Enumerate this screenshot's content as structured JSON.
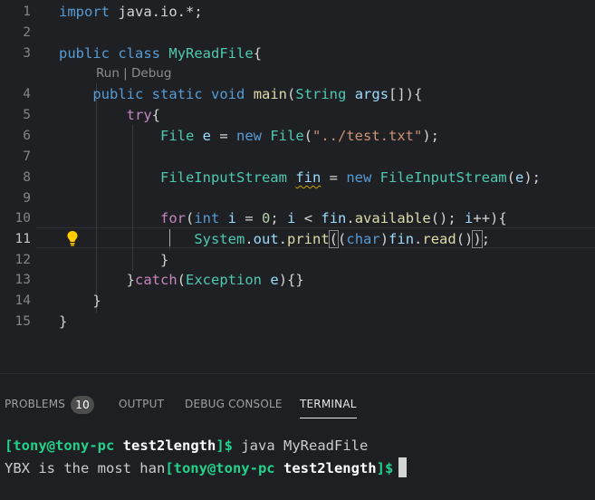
{
  "editor": {
    "codelens": "Run | Debug",
    "lines": [
      {
        "num": "1",
        "tokens": [
          {
            "c": "k",
            "t": "import"
          },
          {
            "c": "p",
            "t": " java.io.*;"
          }
        ]
      },
      {
        "num": "2",
        "tokens": []
      },
      {
        "num": "3",
        "tokens": [
          {
            "c": "k",
            "t": "public"
          },
          {
            "c": "p",
            "t": " "
          },
          {
            "c": "k",
            "t": "class"
          },
          {
            "c": "p",
            "t": " "
          },
          {
            "c": "t",
            "t": "MyReadFile"
          },
          {
            "c": "p",
            "t": "{"
          }
        ]
      },
      {
        "num": "4",
        "tokens": [
          {
            "c": "p",
            "t": "    "
          },
          {
            "c": "k",
            "t": "public"
          },
          {
            "c": "p",
            "t": " "
          },
          {
            "c": "k",
            "t": "static"
          },
          {
            "c": "p",
            "t": " "
          },
          {
            "c": "k",
            "t": "void"
          },
          {
            "c": "p",
            "t": " "
          },
          {
            "c": "f",
            "t": "main"
          },
          {
            "c": "p",
            "t": "("
          },
          {
            "c": "t",
            "t": "String"
          },
          {
            "c": "p",
            "t": " "
          },
          {
            "c": "v",
            "t": "args"
          },
          {
            "c": "p",
            "t": "[]){"
          }
        ]
      },
      {
        "num": "5",
        "tokens": [
          {
            "c": "p",
            "t": "        "
          },
          {
            "c": "kc",
            "t": "try"
          },
          {
            "c": "p",
            "t": "{"
          }
        ]
      },
      {
        "num": "6",
        "tokens": [
          {
            "c": "p",
            "t": "            "
          },
          {
            "c": "t",
            "t": "File"
          },
          {
            "c": "p",
            "t": " "
          },
          {
            "c": "v",
            "t": "e"
          },
          {
            "c": "p",
            "t": " = "
          },
          {
            "c": "k",
            "t": "new"
          },
          {
            "c": "p",
            "t": " "
          },
          {
            "c": "t",
            "t": "File"
          },
          {
            "c": "p",
            "t": "("
          },
          {
            "c": "s",
            "t": "\"../test.txt\""
          },
          {
            "c": "p",
            "t": ");"
          }
        ]
      },
      {
        "num": "7",
        "tokens": []
      },
      {
        "num": "8",
        "tokens": [
          {
            "c": "p",
            "t": "            "
          },
          {
            "c": "t",
            "t": "FileInputStream"
          },
          {
            "c": "p",
            "t": " "
          },
          {
            "c": "v squig",
            "t": "fin"
          },
          {
            "c": "p",
            "t": " = "
          },
          {
            "c": "k",
            "t": "new"
          },
          {
            "c": "p",
            "t": " "
          },
          {
            "c": "t",
            "t": "FileInputStream"
          },
          {
            "c": "p",
            "t": "("
          },
          {
            "c": "v",
            "t": "e"
          },
          {
            "c": "p",
            "t": ");"
          }
        ]
      },
      {
        "num": "9",
        "tokens": []
      },
      {
        "num": "10",
        "tokens": [
          {
            "c": "p",
            "t": "            "
          },
          {
            "c": "kc",
            "t": "for"
          },
          {
            "c": "p",
            "t": "("
          },
          {
            "c": "k",
            "t": "int"
          },
          {
            "c": "p",
            "t": " "
          },
          {
            "c": "v",
            "t": "i"
          },
          {
            "c": "p",
            "t": " = "
          },
          {
            "c": "n",
            "t": "0"
          },
          {
            "c": "p",
            "t": "; "
          },
          {
            "c": "v",
            "t": "i"
          },
          {
            "c": "p",
            "t": " < "
          },
          {
            "c": "v",
            "t": "fin"
          },
          {
            "c": "p",
            "t": "."
          },
          {
            "c": "f",
            "t": "available"
          },
          {
            "c": "p",
            "t": "(); "
          },
          {
            "c": "v",
            "t": "i"
          },
          {
            "c": "p",
            "t": "++){"
          }
        ]
      },
      {
        "num": "11",
        "tokens": [
          {
            "c": "p",
            "t": "                "
          },
          {
            "c": "t",
            "t": "System"
          },
          {
            "c": "p",
            "t": "."
          },
          {
            "c": "v",
            "t": "out"
          },
          {
            "c": "p",
            "t": "."
          },
          {
            "c": "f",
            "t": "print"
          },
          {
            "c": "p bm",
            "t": "("
          },
          {
            "c": "p",
            "t": "("
          },
          {
            "c": "k",
            "t": "char"
          },
          {
            "c": "p",
            "t": ")"
          },
          {
            "c": "v",
            "t": "fin"
          },
          {
            "c": "p",
            "t": "."
          },
          {
            "c": "f",
            "t": "read"
          },
          {
            "c": "p",
            "t": "()"
          },
          {
            "c": "p bm",
            "t": ")"
          },
          {
            "c": "p",
            "t": ";"
          }
        ]
      },
      {
        "num": "12",
        "tokens": [
          {
            "c": "p",
            "t": "            }"
          }
        ]
      },
      {
        "num": "13",
        "tokens": [
          {
            "c": "p",
            "t": "        }"
          },
          {
            "c": "kc",
            "t": "catch"
          },
          {
            "c": "p",
            "t": "("
          },
          {
            "c": "t",
            "t": "Exception"
          },
          {
            "c": "p",
            "t": " "
          },
          {
            "c": "v",
            "t": "e"
          },
          {
            "c": "p",
            "t": "){}"
          }
        ]
      },
      {
        "num": "14",
        "tokens": [
          {
            "c": "p",
            "t": "    }"
          }
        ]
      },
      {
        "num": "15",
        "tokens": [
          {
            "c": "p",
            "t": "}"
          }
        ]
      }
    ],
    "active_line": "11"
  },
  "panel": {
    "tabs": [
      {
        "label": "PROBLEMS",
        "badge": "10"
      },
      {
        "label": "OUTPUT"
      },
      {
        "label": "DEBUG CONSOLE"
      },
      {
        "label": "TERMINAL"
      }
    ],
    "active_tab": "TERMINAL"
  },
  "terminal": {
    "line1": {
      "prompt_user": "[tony@tony-pc",
      "prompt_dir": "test2length",
      "prompt_end": "]$",
      "command": " java MyReadFile"
    },
    "line2": {
      "output": "YBX is the most han",
      "prompt_user": "[tony@tony-pc",
      "prompt_dir": "test2length",
      "prompt_end": "]$"
    }
  },
  "colors": {
    "background": "#1f2023",
    "keyword": "#569cd6",
    "control": "#c586c0",
    "type": "#4ec9b0",
    "function": "#dcdcaa",
    "variable": "#9cdcfe",
    "string": "#ce9178",
    "number": "#b5cea8",
    "prompt_green": "#23d18b"
  }
}
